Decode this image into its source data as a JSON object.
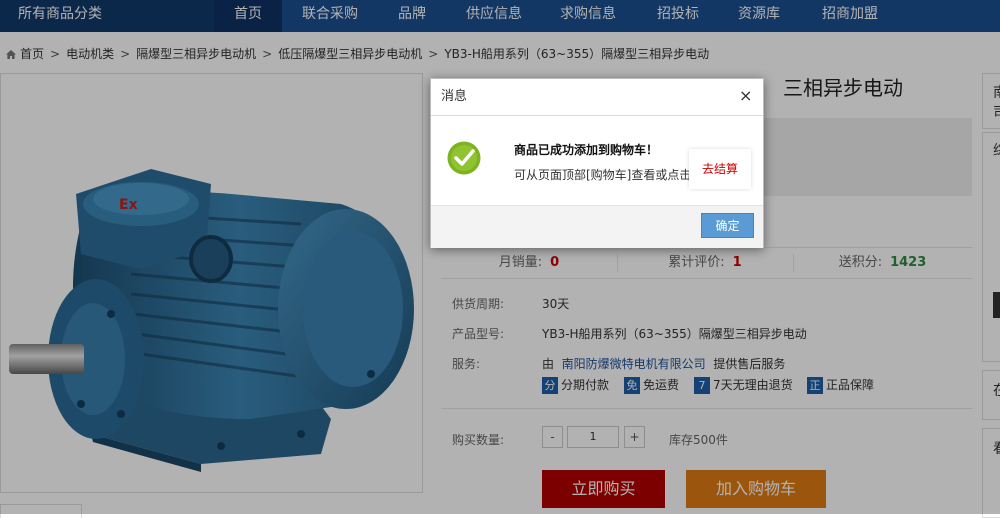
{
  "nav": {
    "all_categories": "所有商品分类",
    "items": [
      "首页",
      "联合采购",
      "品牌",
      "供应信息",
      "求购信息",
      "招投标",
      "资源库",
      "招商加盟"
    ]
  },
  "breadcrumb": [
    "首页",
    "电动机类",
    "隔爆型三相异步电动机",
    "低压隔爆型三相异步电动机",
    "YB3-H船用系列（63~355）隔爆型三相异步电动"
  ],
  "product": {
    "title_visible": "三相异步电动",
    "stats": [
      {
        "label": "月销量:",
        "value": "0"
      },
      {
        "label": "累计评价:",
        "value": "1"
      },
      {
        "label": "送积分:",
        "value": "1423"
      }
    ],
    "supply_cycle_label": "供货周期:",
    "supply_cycle": "30天",
    "model_label": "产品型号:",
    "model": "YB3-H船用系列（63~355）隔爆型三相异步电动",
    "service_label": "服务:",
    "service_prefix": "由",
    "service_company": "南阳防爆微特电机有限公司",
    "service_suffix": "提供售后服务",
    "service_badges": [
      {
        "icon": "分",
        "text": "分期付款"
      },
      {
        "icon": "免",
        "text": "免运费"
      },
      {
        "icon": "7",
        "text": "7天无理由退货"
      },
      {
        "icon": "正",
        "text": "正品保障"
      }
    ],
    "qty_label": "购买数量:",
    "qty_minus": "-",
    "qty_value": "1",
    "qty_plus": "+",
    "stock": "库存500件",
    "buy_now": "立即购买",
    "add_to_cart": "加入购物车",
    "badge_color": "#1e5fa8"
  },
  "sidebar": {
    "glyphs": [
      "南",
      "司",
      "综",
      "在",
      "看"
    ]
  },
  "dialog": {
    "title": "消息",
    "close": "×",
    "message_title": "商品已成功添加到购物车！",
    "message_body": "可从页面顶部[购物车]查看或点击",
    "checkout_link": "去结算",
    "confirm": "确定"
  },
  "colors": {
    "nav_bg": "#1b4f90",
    "buy_red": "#b40000",
    "cart_orange": "#e07a14",
    "confirm_blue": "#5a9bd5"
  }
}
